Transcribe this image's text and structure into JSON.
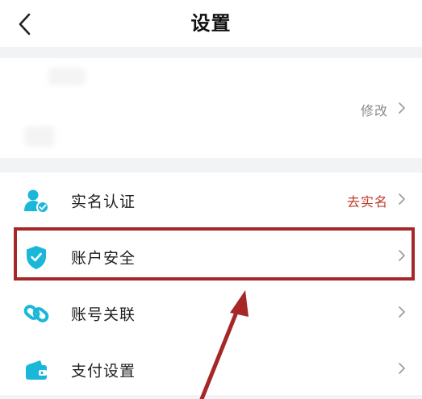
{
  "header": {
    "title": "设置",
    "back_icon": "chevron-left-icon"
  },
  "profile": {
    "edit_label": "修改",
    "edit_icon": "chevron-right-icon"
  },
  "settings": {
    "items": [
      {
        "label": "实名认证",
        "value": "去实名",
        "icon": "user-verified-icon"
      },
      {
        "label": "账户安全",
        "value": "",
        "icon": "shield-check-icon"
      },
      {
        "label": "账号关联",
        "value": "",
        "icon": "link-icon"
      },
      {
        "label": "支付设置",
        "value": "",
        "icon": "wallet-icon"
      }
    ]
  },
  "colors": {
    "accent_icon": "#1bb7d9",
    "value_red": "#c0392b",
    "annotation": "#a52727",
    "separator": "#f2f3f5"
  }
}
